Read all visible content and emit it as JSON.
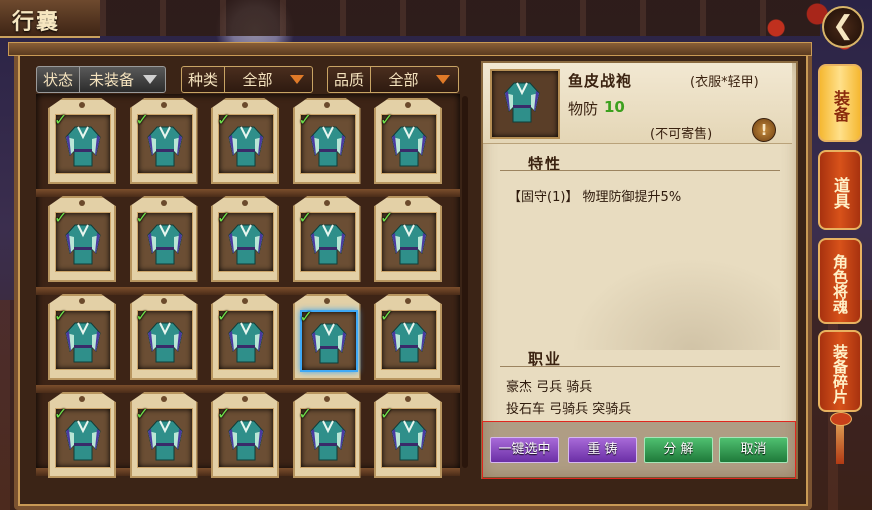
{
  "window": {
    "title": "行囊"
  },
  "filters": {
    "status": {
      "label": "状态",
      "value": "未装备"
    },
    "type": {
      "label": "种类",
      "value": "全部"
    },
    "quality": {
      "label": "品质",
      "value": "全部"
    }
  },
  "grid": {
    "rows": 4,
    "cols": 5,
    "selected_index": 13,
    "check_mark": "✓",
    "item_icon": "robe-icon",
    "check_color": "#6ee04a"
  },
  "detail": {
    "name": "鱼皮战袍",
    "type": "(衣服*轻甲)",
    "stat_label": "物防",
    "stat_value": "10",
    "trade": "(不可寄售)",
    "warning_glyph": "!",
    "traits_header": "特性",
    "trait": "【固守(1)】 物理防御提升5%",
    "jobs_header": "职业",
    "jobs_line1": "豪杰 弓兵 骑兵",
    "jobs_line2": "投石车 弓骑兵 突骑兵"
  },
  "actions": {
    "select_all": "一键选中",
    "recast": "重 铸",
    "decompose": "分 解",
    "cancel": "取消"
  },
  "side_tabs": {
    "equip": "装备",
    "items": "道具",
    "soul": "角色将魂",
    "fragments": "装备碎片"
  },
  "back_glyph": "❮",
  "colors": {
    "selected_border": "#3fa9f5",
    "stat_green": "#3ca01e",
    "action_box": "#e0261e"
  }
}
